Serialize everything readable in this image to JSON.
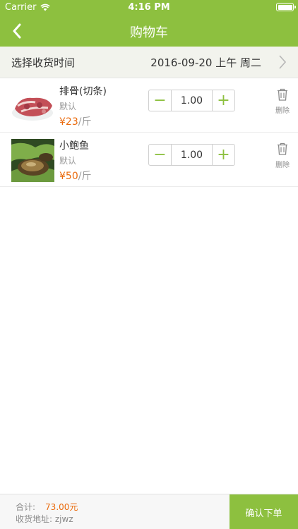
{
  "status_bar": {
    "carrier": "Carrier",
    "time": "4:16 PM"
  },
  "nav": {
    "title": "购物车"
  },
  "delivery": {
    "label": "选择收货时间",
    "value": "2016-09-20 上午 周二"
  },
  "items": [
    {
      "name": "排骨(切条)",
      "spec": "默认",
      "price": "¥23",
      "unit": "/斤",
      "quantity": "1.00",
      "delete_label": "删除"
    },
    {
      "name": "小鲍鱼",
      "spec": "默认",
      "price": "¥50",
      "unit": "/斤",
      "quantity": "1.00",
      "delete_label": "删除"
    }
  ],
  "stepper": {
    "minus": "−",
    "plus": "+"
  },
  "footer": {
    "total_label": "合计:",
    "total_value": "73.00元",
    "address_label": "收货地址:",
    "address_value": "zjwz",
    "confirm_label": "确认下单"
  },
  "colors": {
    "accent": "#8dc03f",
    "price": "#ea6a0c",
    "background": "#ffffff"
  },
  "icons": [
    "back-arrow-icon",
    "wifi-icon",
    "battery-icon",
    "chevron-right-icon",
    "trash-icon"
  ]
}
